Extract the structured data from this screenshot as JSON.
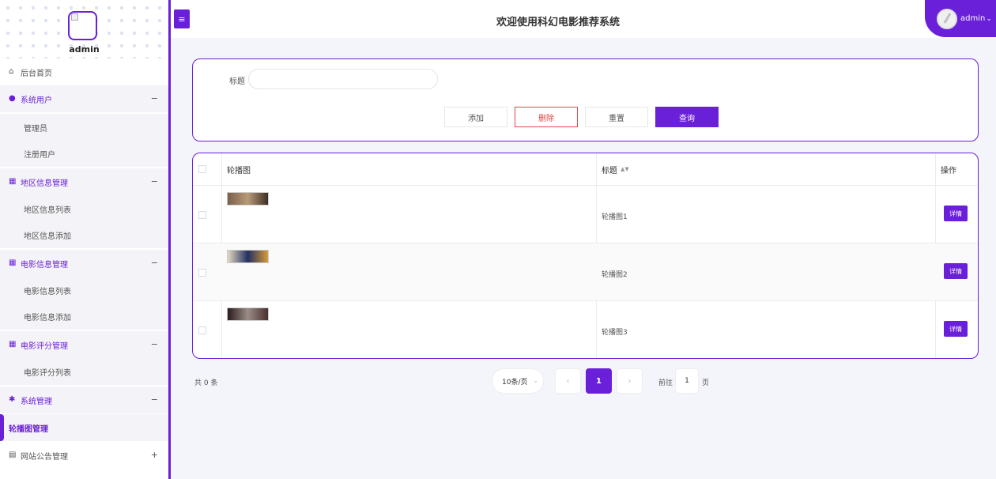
{
  "colors": {
    "accent": "#6a1fd8",
    "danger": "#e04646"
  },
  "sidebar": {
    "username": "admin",
    "items": [
      {
        "label": "后台首页",
        "type": "top",
        "icon": "home-icon"
      },
      {
        "label": "系统用户",
        "type": "group",
        "icon": "user-icon",
        "toggle": "−"
      },
      {
        "label": "管理员",
        "type": "sub"
      },
      {
        "label": "注册用户",
        "type": "sub"
      },
      {
        "label": "地区信息管理",
        "type": "group",
        "icon": "grid-icon",
        "toggle": "−"
      },
      {
        "label": "地区信息列表",
        "type": "sub"
      },
      {
        "label": "地区信息添加",
        "type": "sub"
      },
      {
        "label": "电影信息管理",
        "type": "group",
        "icon": "grid-icon",
        "toggle": "−"
      },
      {
        "label": "电影信息列表",
        "type": "sub"
      },
      {
        "label": "电影信息添加",
        "type": "sub"
      },
      {
        "label": "电影评分管理",
        "type": "group",
        "icon": "grid-icon",
        "toggle": "−"
      },
      {
        "label": "电影评分列表",
        "type": "sub"
      },
      {
        "label": "系统管理",
        "type": "group",
        "icon": "gear-icon",
        "toggle": "−"
      },
      {
        "label": "轮播图管理",
        "type": "active"
      },
      {
        "label": "网站公告管理",
        "type": "top",
        "icon": "document-icon",
        "toggle": "+"
      }
    ]
  },
  "header": {
    "menu_icon": "≡",
    "title": "欢迎使用科幻电影推荐系统",
    "user": "admin",
    "user_caret": "⌄"
  },
  "search": {
    "label": "标题",
    "value": "",
    "placeholder": "",
    "add_label": "添加",
    "delete_label": "删除",
    "reset_label": "重置",
    "query_label": "查询"
  },
  "table": {
    "columns": [
      "轮播图",
      "标题",
      "操作"
    ],
    "sort_icon": "▲▼",
    "rows": [
      {
        "title": "轮播图1",
        "action": "详情",
        "thumb": [
          "#7a6048",
          "#b99a77",
          "#3d2f25"
        ]
      },
      {
        "title": "轮播图2",
        "action": "详情",
        "thumb": [
          "#e4d9c0",
          "#243060",
          "#d79a3a"
        ]
      },
      {
        "title": "轮播图3",
        "action": "详情",
        "thumb": [
          "#2a1c1c",
          "#9b8c87",
          "#4b2f2f"
        ]
      }
    ]
  },
  "pagination": {
    "total": "共 0 条",
    "page_size": "10条/页",
    "page_size_caret": "⌄",
    "prev": "‹",
    "current_page": "1",
    "next": "›",
    "goto_label": "前往",
    "goto_value": "1",
    "goto_unit": "页"
  }
}
